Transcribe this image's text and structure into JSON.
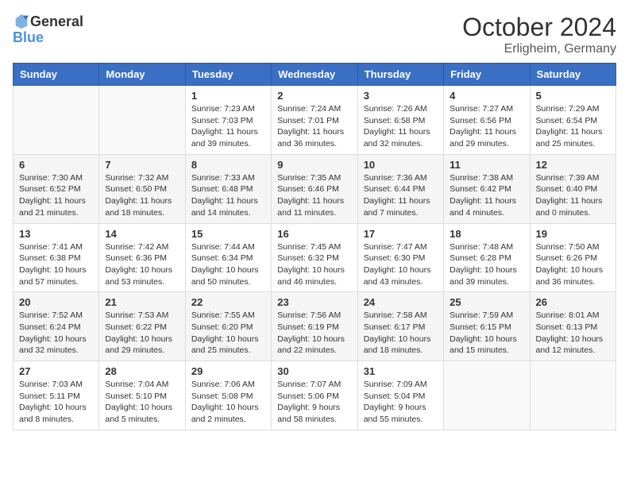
{
  "header": {
    "logo_general": "General",
    "logo_blue": "Blue",
    "month": "October 2024",
    "location": "Erligheim, Germany"
  },
  "weekdays": [
    "Sunday",
    "Monday",
    "Tuesday",
    "Wednesday",
    "Thursday",
    "Friday",
    "Saturday"
  ],
  "weeks": [
    [
      {
        "day": "",
        "info": ""
      },
      {
        "day": "",
        "info": ""
      },
      {
        "day": "1",
        "info": "Sunrise: 7:23 AM\nSunset: 7:03 PM\nDaylight: 11 hours and 39 minutes."
      },
      {
        "day": "2",
        "info": "Sunrise: 7:24 AM\nSunset: 7:01 PM\nDaylight: 11 hours and 36 minutes."
      },
      {
        "day": "3",
        "info": "Sunrise: 7:26 AM\nSunset: 6:58 PM\nDaylight: 11 hours and 32 minutes."
      },
      {
        "day": "4",
        "info": "Sunrise: 7:27 AM\nSunset: 6:56 PM\nDaylight: 11 hours and 29 minutes."
      },
      {
        "day": "5",
        "info": "Sunrise: 7:29 AM\nSunset: 6:54 PM\nDaylight: 11 hours and 25 minutes."
      }
    ],
    [
      {
        "day": "6",
        "info": "Sunrise: 7:30 AM\nSunset: 6:52 PM\nDaylight: 11 hours and 21 minutes."
      },
      {
        "day": "7",
        "info": "Sunrise: 7:32 AM\nSunset: 6:50 PM\nDaylight: 11 hours and 18 minutes."
      },
      {
        "day": "8",
        "info": "Sunrise: 7:33 AM\nSunset: 6:48 PM\nDaylight: 11 hours and 14 minutes."
      },
      {
        "day": "9",
        "info": "Sunrise: 7:35 AM\nSunset: 6:46 PM\nDaylight: 11 hours and 11 minutes."
      },
      {
        "day": "10",
        "info": "Sunrise: 7:36 AM\nSunset: 6:44 PM\nDaylight: 11 hours and 7 minutes."
      },
      {
        "day": "11",
        "info": "Sunrise: 7:38 AM\nSunset: 6:42 PM\nDaylight: 11 hours and 4 minutes."
      },
      {
        "day": "12",
        "info": "Sunrise: 7:39 AM\nSunset: 6:40 PM\nDaylight: 11 hours and 0 minutes."
      }
    ],
    [
      {
        "day": "13",
        "info": "Sunrise: 7:41 AM\nSunset: 6:38 PM\nDaylight: 10 hours and 57 minutes."
      },
      {
        "day": "14",
        "info": "Sunrise: 7:42 AM\nSunset: 6:36 PM\nDaylight: 10 hours and 53 minutes."
      },
      {
        "day": "15",
        "info": "Sunrise: 7:44 AM\nSunset: 6:34 PM\nDaylight: 10 hours and 50 minutes."
      },
      {
        "day": "16",
        "info": "Sunrise: 7:45 AM\nSunset: 6:32 PM\nDaylight: 10 hours and 46 minutes."
      },
      {
        "day": "17",
        "info": "Sunrise: 7:47 AM\nSunset: 6:30 PM\nDaylight: 10 hours and 43 minutes."
      },
      {
        "day": "18",
        "info": "Sunrise: 7:48 AM\nSunset: 6:28 PM\nDaylight: 10 hours and 39 minutes."
      },
      {
        "day": "19",
        "info": "Sunrise: 7:50 AM\nSunset: 6:26 PM\nDaylight: 10 hours and 36 minutes."
      }
    ],
    [
      {
        "day": "20",
        "info": "Sunrise: 7:52 AM\nSunset: 6:24 PM\nDaylight: 10 hours and 32 minutes."
      },
      {
        "day": "21",
        "info": "Sunrise: 7:53 AM\nSunset: 6:22 PM\nDaylight: 10 hours and 29 minutes."
      },
      {
        "day": "22",
        "info": "Sunrise: 7:55 AM\nSunset: 6:20 PM\nDaylight: 10 hours and 25 minutes."
      },
      {
        "day": "23",
        "info": "Sunrise: 7:56 AM\nSunset: 6:19 PM\nDaylight: 10 hours and 22 minutes."
      },
      {
        "day": "24",
        "info": "Sunrise: 7:58 AM\nSunset: 6:17 PM\nDaylight: 10 hours and 18 minutes."
      },
      {
        "day": "25",
        "info": "Sunrise: 7:59 AM\nSunset: 6:15 PM\nDaylight: 10 hours and 15 minutes."
      },
      {
        "day": "26",
        "info": "Sunrise: 8:01 AM\nSunset: 6:13 PM\nDaylight: 10 hours and 12 minutes."
      }
    ],
    [
      {
        "day": "27",
        "info": "Sunrise: 7:03 AM\nSunset: 5:11 PM\nDaylight: 10 hours and 8 minutes."
      },
      {
        "day": "28",
        "info": "Sunrise: 7:04 AM\nSunset: 5:10 PM\nDaylight: 10 hours and 5 minutes."
      },
      {
        "day": "29",
        "info": "Sunrise: 7:06 AM\nSunset: 5:08 PM\nDaylight: 10 hours and 2 minutes."
      },
      {
        "day": "30",
        "info": "Sunrise: 7:07 AM\nSunset: 5:06 PM\nDaylight: 9 hours and 58 minutes."
      },
      {
        "day": "31",
        "info": "Sunrise: 7:09 AM\nSunset: 5:04 PM\nDaylight: 9 hours and 55 minutes."
      },
      {
        "day": "",
        "info": ""
      },
      {
        "day": "",
        "info": ""
      }
    ]
  ]
}
